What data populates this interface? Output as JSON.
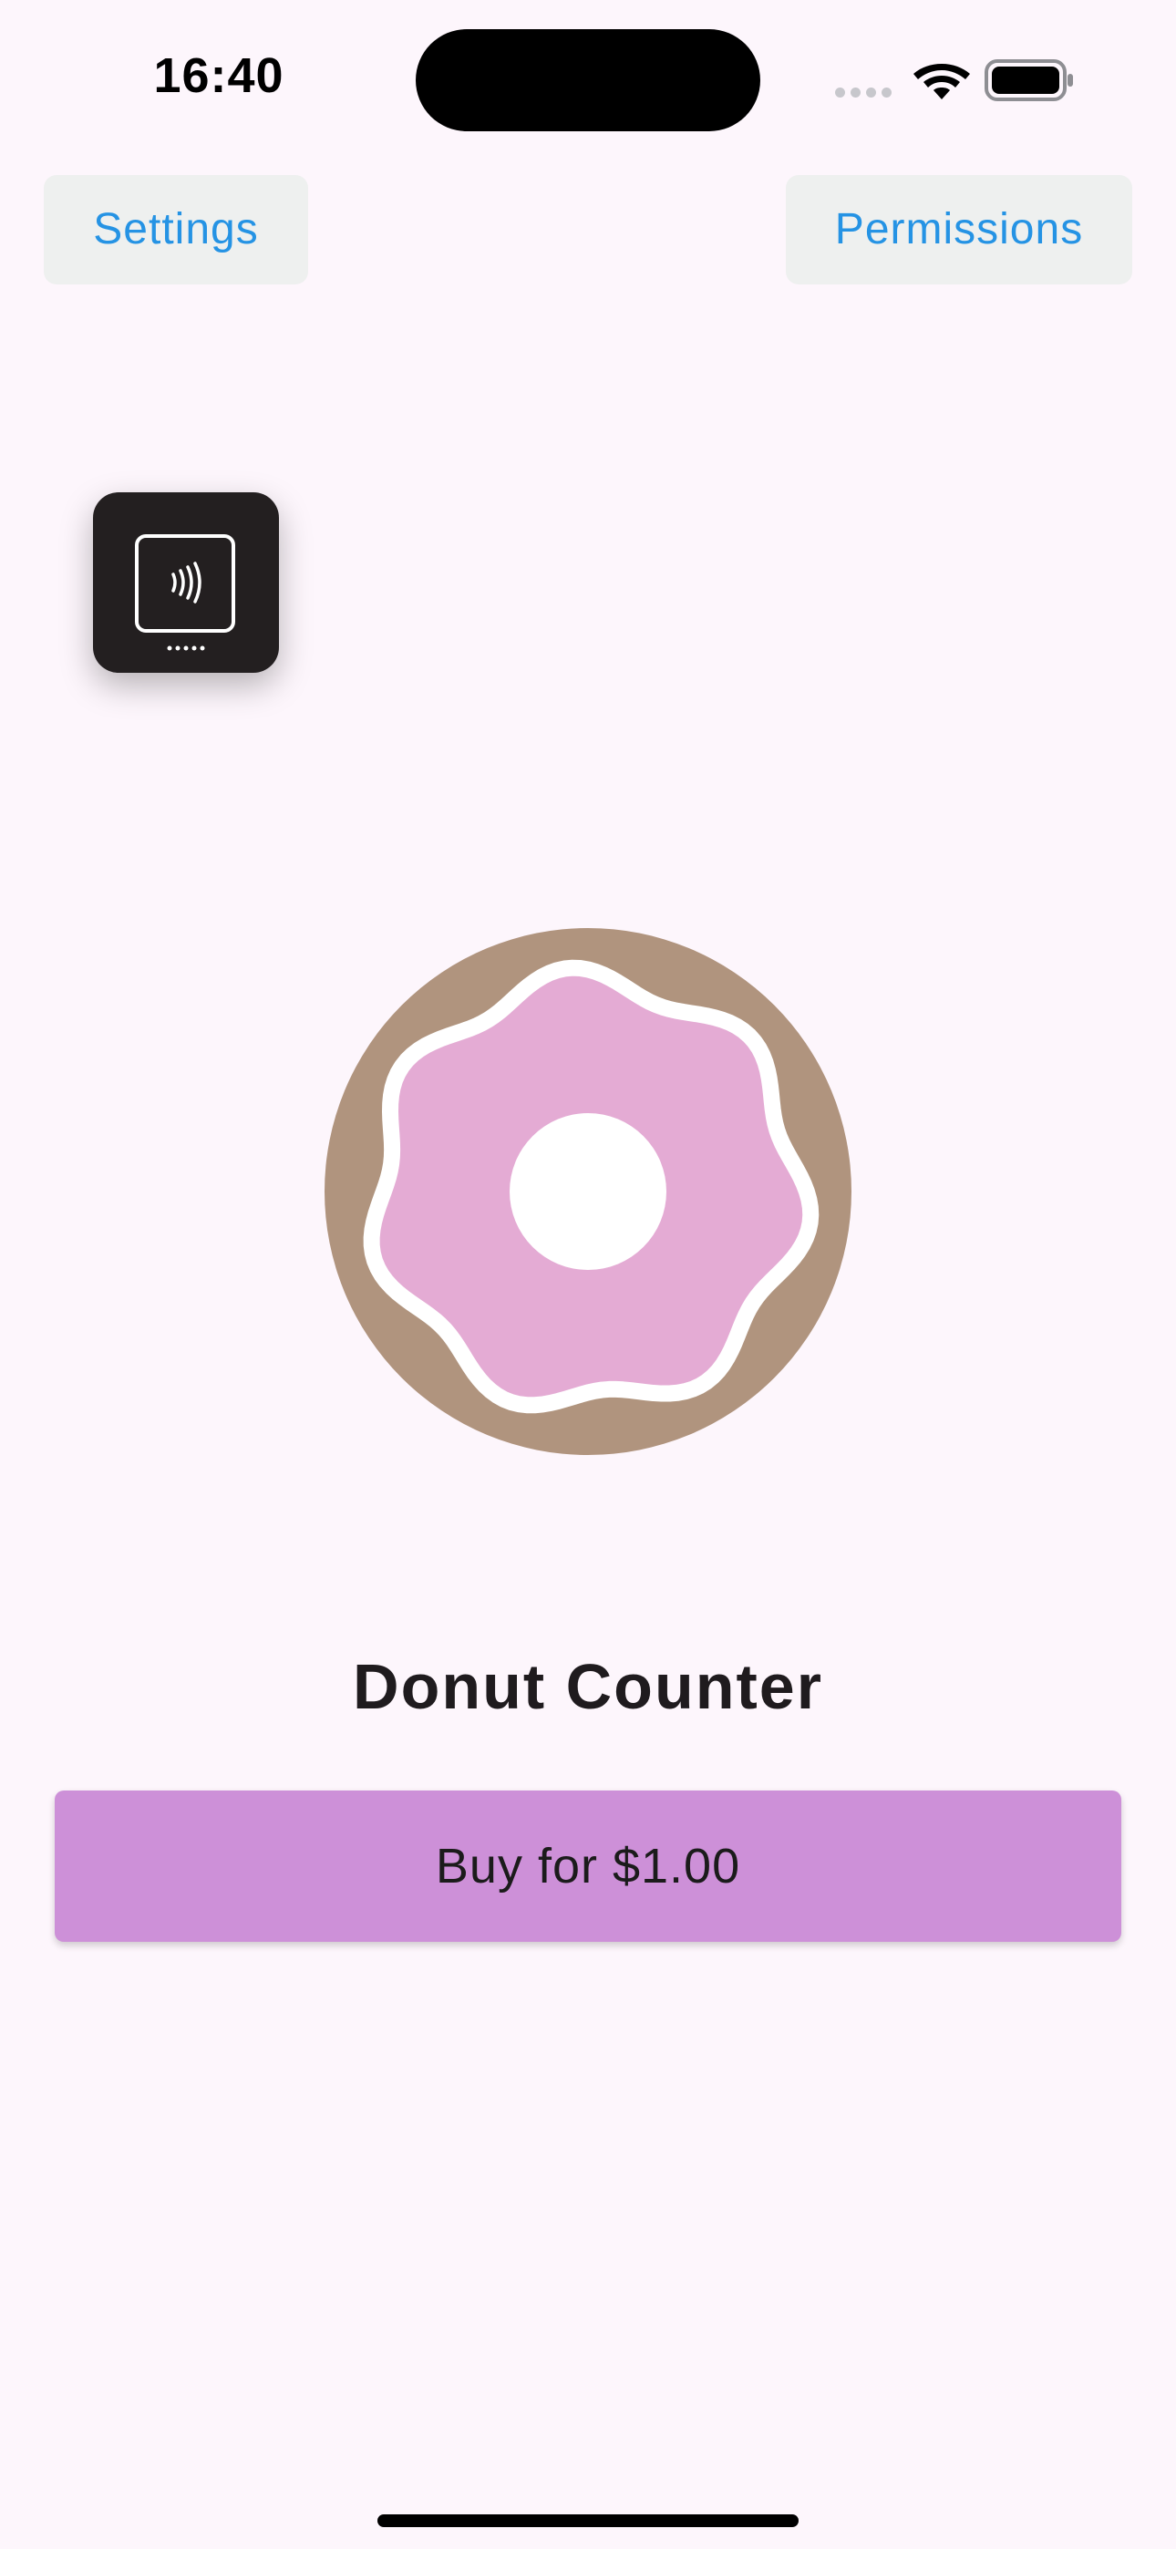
{
  "status_bar": {
    "time": "16:40"
  },
  "top_bar": {
    "settings_label": "Settings",
    "permissions_label": "Permissions"
  },
  "reader": {
    "icon": "contactless-reader-icon"
  },
  "main": {
    "logo_icon": "donut-icon",
    "title": "Donut Counter",
    "buy_label": "Buy for $1.00"
  },
  "colors": {
    "background": "#fdf6fc",
    "button_text": "#2593e4",
    "top_button_bg": "#eef0ef",
    "buy_button_bg": "#cd90d8",
    "donut_dough": "#b0947e",
    "donut_icing": "#e4abd4"
  }
}
